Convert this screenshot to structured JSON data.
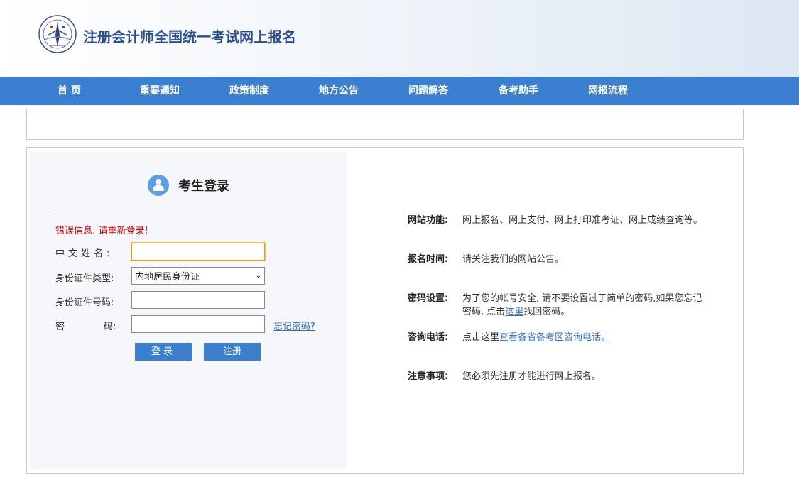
{
  "header": {
    "site_title": "注册会计师全国统一考试网上报名"
  },
  "nav": {
    "items": [
      "首 页",
      "重要通知",
      "政策制度",
      "地方公告",
      "问题解答",
      "备考助手",
      "网报流程"
    ]
  },
  "login": {
    "title": "考生登录",
    "error_message": "错误信息: 请重新登录!",
    "name_label": "中文姓名:",
    "name_value": "",
    "id_type_label": "身份证件类型:",
    "id_type_selected": "内地居民身份证",
    "id_number_label": "身份证件号码:",
    "id_number_value": "",
    "password_label_1": "密",
    "password_label_2": "码:",
    "password_value": "",
    "forgot_password": "忘记密码?",
    "login_button": "登录",
    "register_button": "注册"
  },
  "info": {
    "function_label": "网站功能:",
    "function_text": "网上报名、网上支付、网上打印准考证、网上成绩查询等。",
    "time_label": "报名时间:",
    "time_text": "请关注我们的网站公告。",
    "password_label": "密码设置:",
    "password_text_before": "为了您的帐号安全, 请不要设置过于简单的密码,如果您忘记密码, 点击",
    "password_link": "这里",
    "password_text_after": "找回密码。",
    "contact_label": "咨询电话:",
    "contact_text_before": "点击这里",
    "contact_link": "查看各省各考区咨询电话。",
    "notice_label": "注意事项:",
    "notice_text": "您必须先注册才能进行网上报名。"
  }
}
